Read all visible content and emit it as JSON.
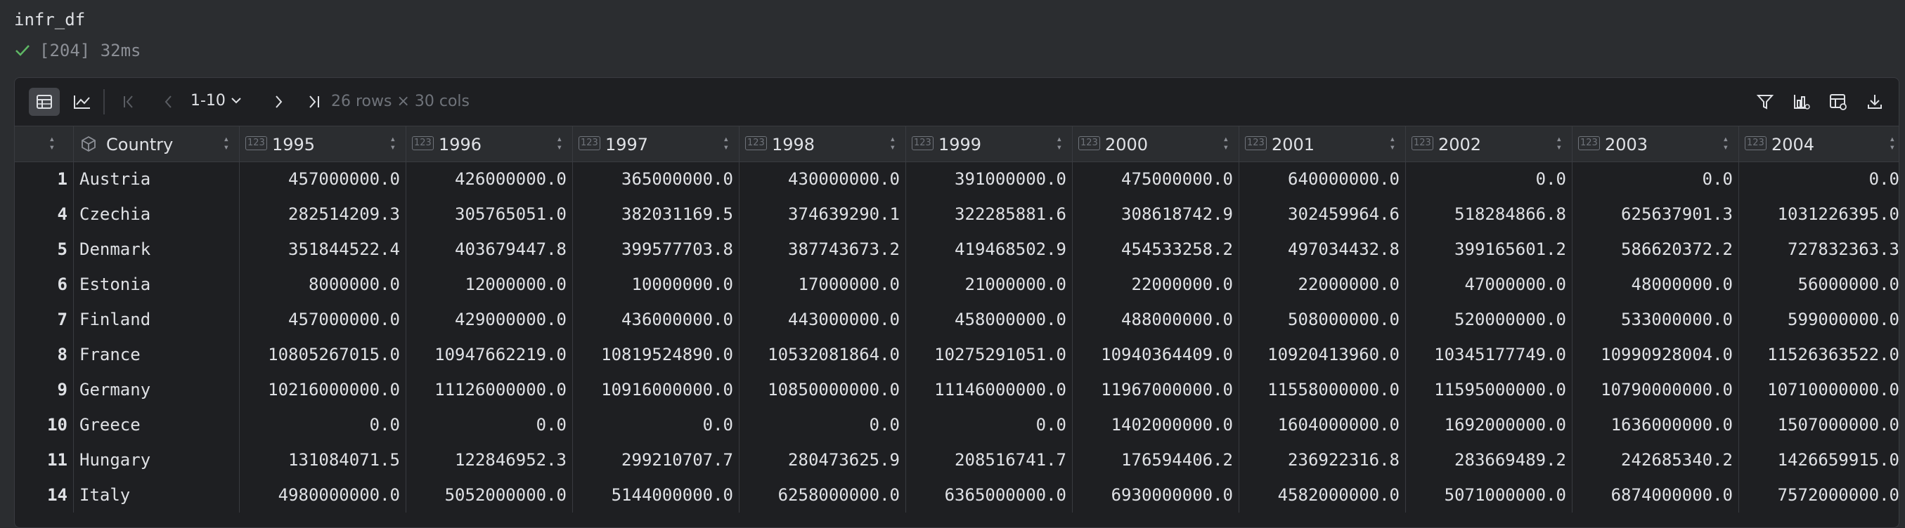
{
  "cell": {
    "title": "infr_df",
    "status": "[204] 32ms"
  },
  "toolbar": {
    "page_range": "1-10",
    "rows_info": "26 rows × 30 cols"
  },
  "icons": {
    "table_view": "table-icon",
    "chart_view": "line-chart-icon",
    "first_page": "first-page-icon",
    "prev_page": "prev-page-icon",
    "next_page": "next-page-icon",
    "last_page": "last-page-icon",
    "filter": "filter-icon",
    "chart_settings": "chart-settings-icon",
    "table_settings": "table-settings-icon",
    "download": "download-icon"
  },
  "table": {
    "columns": [
      "Country",
      "1995",
      "1996",
      "1997",
      "1998",
      "1999",
      "2000",
      "2001",
      "2002",
      "2003",
      "2004"
    ],
    "type_label": "123",
    "rows": [
      {
        "idx": "1",
        "cells": [
          "Austria",
          "457000000.0",
          "426000000.0",
          "365000000.0",
          "430000000.0",
          "391000000.0",
          "475000000.0",
          "640000000.0",
          "0.0",
          "0.0",
          "0.0"
        ]
      },
      {
        "idx": "4",
        "cells": [
          "Czechia",
          "282514209.3",
          "305765051.0",
          "382031169.5",
          "374639290.1",
          "322285881.6",
          "308618742.9",
          "302459964.6",
          "518284866.8",
          "625637901.3",
          "1031226395.0"
        ]
      },
      {
        "idx": "5",
        "cells": [
          "Denmark",
          "351844522.4",
          "403679447.8",
          "399577703.8",
          "387743673.2",
          "419468502.9",
          "454533258.2",
          "497034432.8",
          "399165601.2",
          "586620372.2",
          "727832363.3"
        ]
      },
      {
        "idx": "6",
        "cells": [
          "Estonia",
          "8000000.0",
          "12000000.0",
          "10000000.0",
          "17000000.0",
          "21000000.0",
          "22000000.0",
          "22000000.0",
          "47000000.0",
          "48000000.0",
          "56000000.0"
        ]
      },
      {
        "idx": "7",
        "cells": [
          "Finland",
          "457000000.0",
          "429000000.0",
          "436000000.0",
          "443000000.0",
          "458000000.0",
          "488000000.0",
          "508000000.0",
          "520000000.0",
          "533000000.0",
          "599000000.0"
        ]
      },
      {
        "idx": "8",
        "cells": [
          "France",
          "10805267015.0",
          "10947662219.0",
          "10819524890.0",
          "10532081864.0",
          "10275291051.0",
          "10940364409.0",
          "10920413960.0",
          "10345177749.0",
          "10990928004.0",
          "11526363522.0"
        ]
      },
      {
        "idx": "9",
        "cells": [
          "Germany",
          "10216000000.0",
          "11126000000.0",
          "10916000000.0",
          "10850000000.0",
          "11146000000.0",
          "11967000000.0",
          "11558000000.0",
          "11595000000.0",
          "10790000000.0",
          "10710000000.0"
        ]
      },
      {
        "idx": "10",
        "cells": [
          "Greece",
          "0.0",
          "0.0",
          "0.0",
          "0.0",
          "0.0",
          "1402000000.0",
          "1604000000.0",
          "1692000000.0",
          "1636000000.0",
          "1507000000.0"
        ]
      },
      {
        "idx": "11",
        "cells": [
          "Hungary",
          "131084071.5",
          "122846952.3",
          "299210707.7",
          "280473625.9",
          "208516741.7",
          "176594406.2",
          "236922316.8",
          "283669489.2",
          "242685340.2",
          "1426659915.0"
        ]
      },
      {
        "idx": "14",
        "cells": [
          "Italy",
          "4980000000.0",
          "5052000000.0",
          "5144000000.0",
          "6258000000.0",
          "6365000000.0",
          "6930000000.0",
          "4582000000.0",
          "5071000000.0",
          "6874000000.0",
          "7572000000.0"
        ]
      }
    ]
  }
}
